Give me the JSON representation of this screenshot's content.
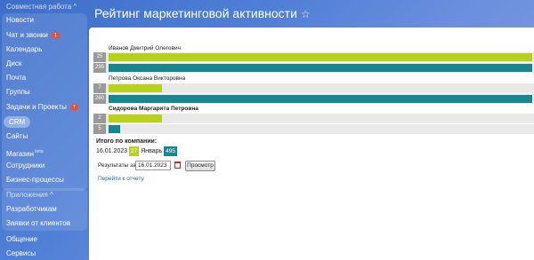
{
  "sidebar": {
    "section_collab": "Совместная работа ^",
    "items": [
      {
        "label": "Новости"
      },
      {
        "label": "Чат и звонки",
        "badge": "1"
      },
      {
        "label": "Календарь"
      },
      {
        "label": "Диск"
      },
      {
        "label": "Почта"
      },
      {
        "label": "Группы"
      },
      {
        "label": "Задачи и Проекты",
        "badge": "7"
      },
      {
        "label": "CRM"
      },
      {
        "label": "Сайты"
      },
      {
        "label": "Магазин",
        "sup": "beta"
      },
      {
        "label": "Сотрудники"
      },
      {
        "label": "Бизнес-процессы"
      }
    ],
    "section_apps": "Приложения ^",
    "app_items": [
      {
        "label": "Разработчикам"
      },
      {
        "label": "Заявки от клиентов"
      }
    ],
    "bottom_items": [
      {
        "label": "Общение"
      },
      {
        "label": "Сервисы"
      }
    ]
  },
  "page": {
    "title": "Рейтинг маркетинговой активности",
    "star": "☆"
  },
  "colors": {
    "lime": "#b8d21a",
    "teal": "#17868f",
    "badge": "#e8503a"
  },
  "rating": [
    {
      "name": "Иванов Дмитрий Олегович",
      "bold": false,
      "rows": [
        {
          "value": "25",
          "color": "lime",
          "fraction": 1.0
        },
        {
          "value": "295",
          "color": "teal",
          "fraction": 1.0
        }
      ]
    },
    {
      "name": "Петрова Оксана Викторовна",
      "bold": false,
      "rows": [
        {
          "value": "7",
          "color": "lime",
          "fraction": 0.125
        },
        {
          "value": "260",
          "color": "teal",
          "fraction": 1.0
        }
      ]
    },
    {
      "name": "Сидорова Маргарита Петровна",
      "bold": true,
      "rows": [
        {
          "value": "2",
          "color": "lime",
          "fraction": 0.127
        },
        {
          "value": "5",
          "color": "teal",
          "fraction": 0.028
        }
      ]
    }
  ],
  "summary": {
    "title": "Итого по компании:",
    "date": "16.01.2023",
    "lime_value": "27",
    "month": "Январь",
    "teal_value": "495"
  },
  "filter": {
    "label": "Результаты за:",
    "date_value": "16.01.2023",
    "button_label": "Просмотр"
  },
  "link": {
    "label": "Перейти к отчету"
  }
}
